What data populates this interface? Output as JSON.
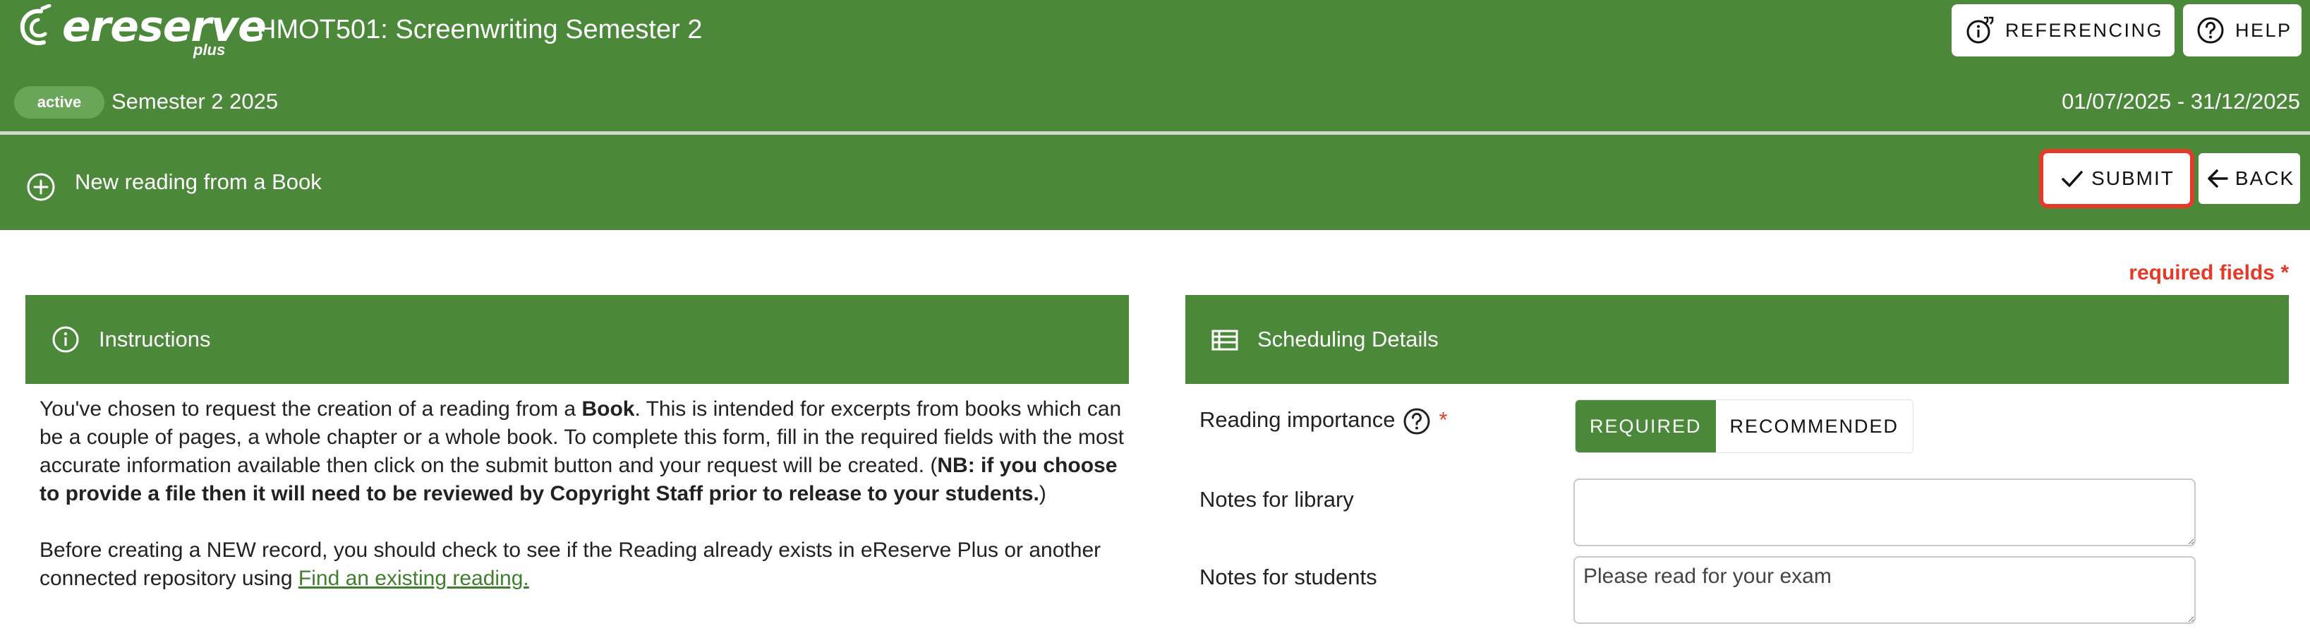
{
  "header": {
    "logo_text": "ereserve",
    "logo_sub": "plus",
    "course_title": "HMOT501: Screenwriting Semester 2",
    "referencing_label": "REFERENCING",
    "help_label": "HELP",
    "status": "active",
    "semester": "Semester 2 2025",
    "date_range": "01/07/2025 - 31/12/2025"
  },
  "action_bar": {
    "title": "New reading from a Book",
    "submit_label": "SUBMIT",
    "back_label": "BACK"
  },
  "required_note": "required fields *",
  "instructions": {
    "heading": "Instructions",
    "p1_a": "You've chosen to request the creation of a reading from a ",
    "p1_book": "Book",
    "p1_b": ". This is intended for excerpts from books which can be a couple of pages, a whole chapter or a whole book. To complete this form, fill in the required fields with the most accurate information available then click on the submit button and your request will be created. (",
    "p1_nb": "NB: if you choose to provide a file then it will need to be reviewed by Copyright Staff prior to release to your students.",
    "p1_c": ")",
    "p2_a": "Before creating a NEW record, you should check to see if the Reading already exists in eReserve Plus or another connected repository using ",
    "p2_link": "Find an existing reading."
  },
  "scheduling": {
    "heading": "Scheduling Details",
    "importance_label": "Reading importance",
    "required_star": "*",
    "importance_options": [
      "REQUIRED",
      "RECOMMENDED"
    ],
    "importance_selected": "REQUIRED",
    "notes_library_label": "Notes for library",
    "notes_library_value": "",
    "notes_students_label": "Notes for students",
    "notes_students_value": "Please read for your exam"
  },
  "colors": {
    "brand_green": "#4b883a",
    "accent_red": "#e53a28",
    "link_green": "#3f7f2e"
  },
  "icons": [
    "ereserve-logo-icon",
    "referencing-icon",
    "help-icon",
    "add-circle-icon",
    "check-icon",
    "arrow-left-icon",
    "info-icon",
    "list-icon",
    "question-icon"
  ]
}
